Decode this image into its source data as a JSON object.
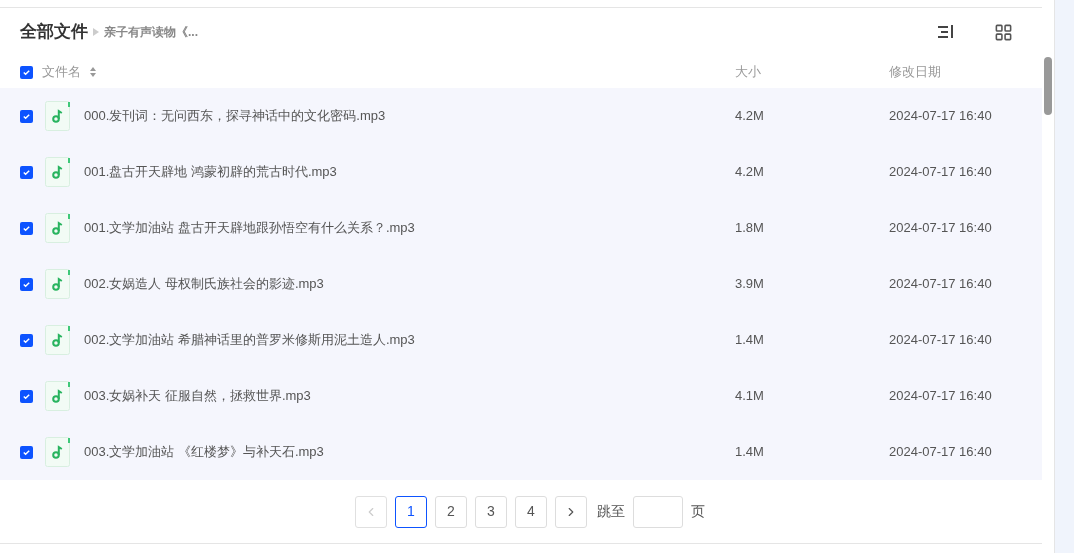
{
  "breadcrumb": {
    "root": "全部文件",
    "current": "亲子有声读物《..."
  },
  "table": {
    "all_checked": true,
    "columns": [
      "文件名",
      "大小",
      "修改日期"
    ],
    "rows": [
      {
        "name": "000.发刊词：无问西东，探寻神话中的文化密码.mp3",
        "size": "4.2M",
        "date": "2024-07-17 16:40",
        "checked": true
      },
      {
        "name": "001.盘古开天辟地 鸿蒙初辟的荒古时代.mp3",
        "size": "4.2M",
        "date": "2024-07-17 16:40",
        "checked": true
      },
      {
        "name": "001.文学加油站 盘古开天辟地跟孙悟空有什么关系？.mp3",
        "size": "1.8M",
        "date": "2024-07-17 16:40",
        "checked": true
      },
      {
        "name": "002.女娲造人 母权制氏族社会的影迹.mp3",
        "size": "3.9M",
        "date": "2024-07-17 16:40",
        "checked": true
      },
      {
        "name": "002.文学加油站 希腊神话里的普罗米修斯用泥土造人.mp3",
        "size": "1.4M",
        "date": "2024-07-17 16:40",
        "checked": true
      },
      {
        "name": "003.女娲补天 征服自然，拯救世界.mp3",
        "size": "4.1M",
        "date": "2024-07-17 16:40",
        "checked": true
      },
      {
        "name": "003.文学加油站 《红楼梦》与补天石.mp3",
        "size": "1.4M",
        "date": "2024-07-17 16:40",
        "checked": true
      }
    ]
  },
  "pagination": {
    "prev_disabled": true,
    "pages": [
      {
        "label": "1",
        "selected": true
      },
      {
        "label": "2",
        "selected": false
      },
      {
        "label": "3",
        "selected": false
      },
      {
        "label": "4",
        "selected": false
      }
    ],
    "jump_label": "跳至",
    "page_suffix": "页"
  }
}
